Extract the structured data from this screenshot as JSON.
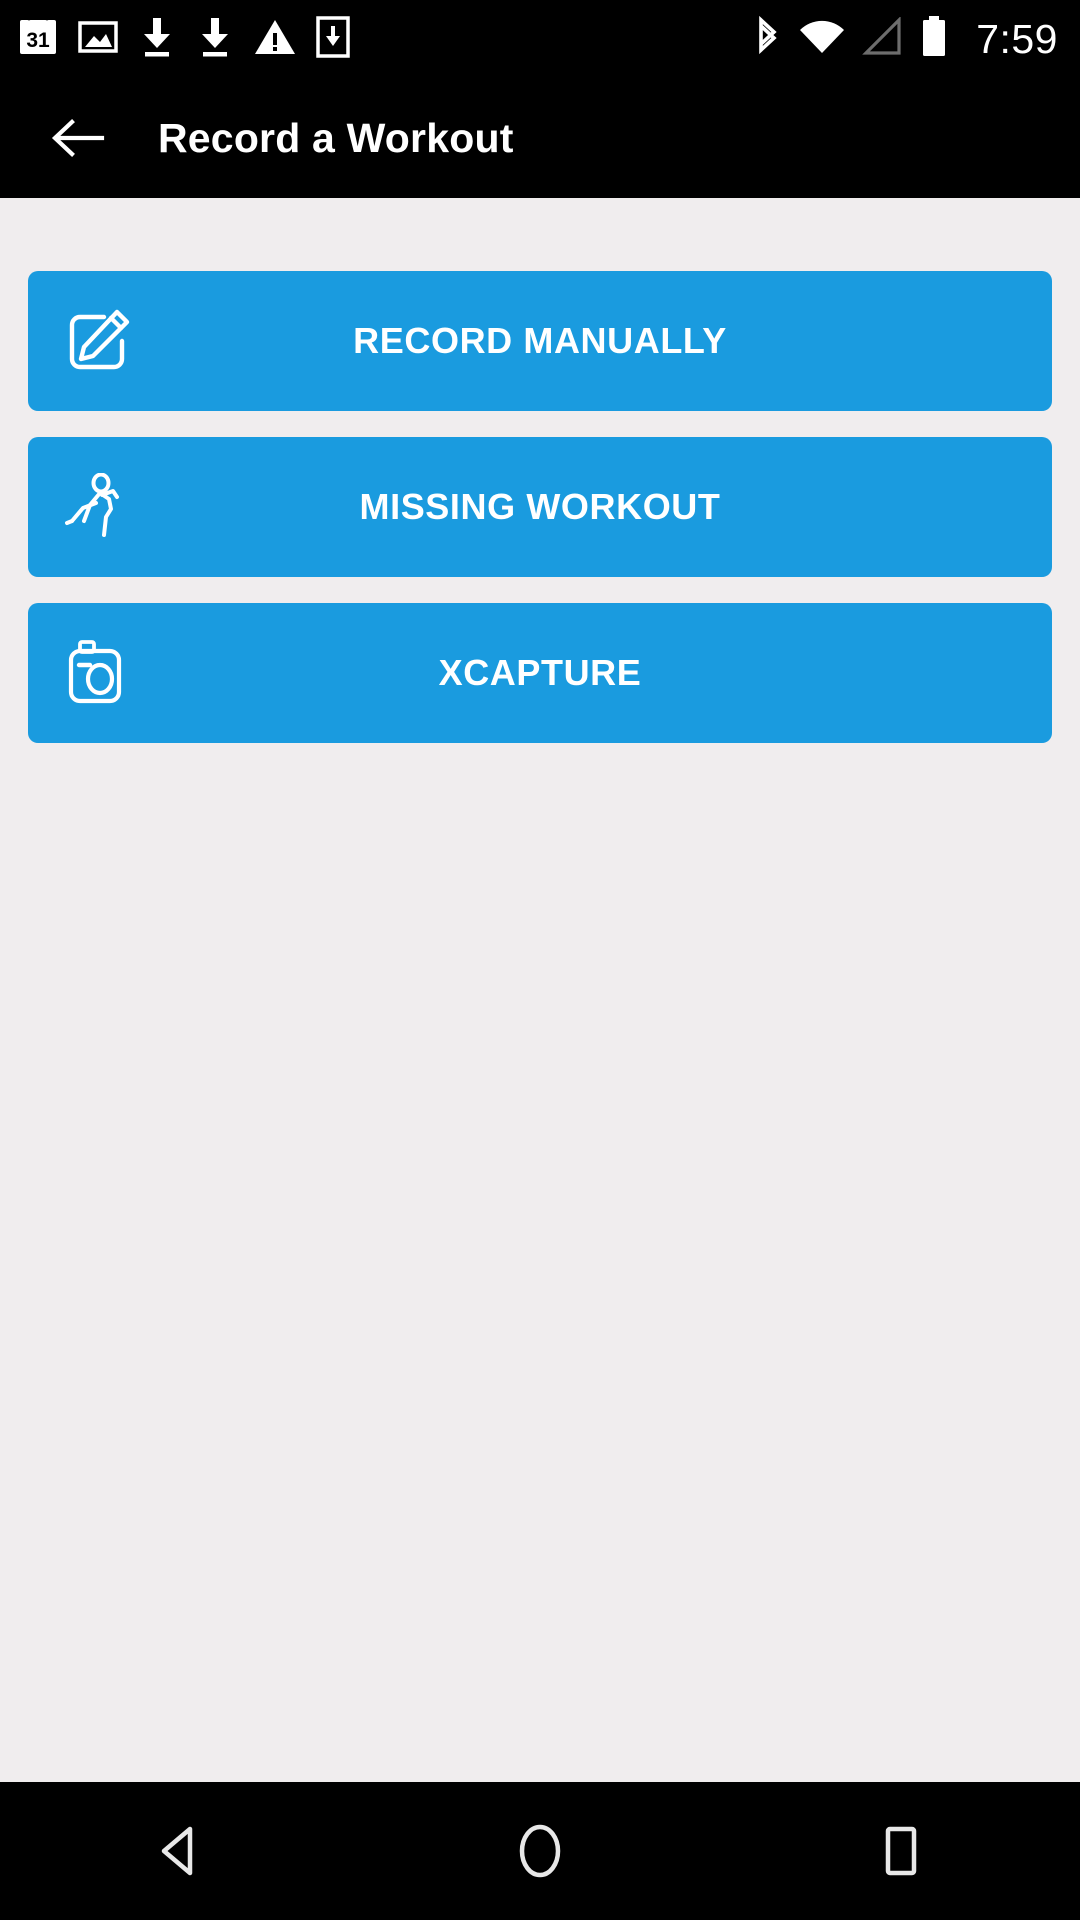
{
  "status_bar": {
    "time": "7:59",
    "left_icons": [
      {
        "name": "calendar-icon",
        "label": "31"
      },
      {
        "name": "image-icon",
        "label": ""
      },
      {
        "name": "download-icon",
        "label": ""
      },
      {
        "name": "download-icon-2",
        "label": ""
      },
      {
        "name": "warning-icon",
        "label": ""
      },
      {
        "name": "save-to-device-icon",
        "label": ""
      }
    ],
    "right_icons": [
      {
        "name": "bluetooth-icon"
      },
      {
        "name": "wifi-icon"
      },
      {
        "name": "cellular-signal-icon"
      },
      {
        "name": "battery-icon"
      }
    ]
  },
  "app_bar": {
    "title": "Record a Workout",
    "back_icon": "arrow-left-icon"
  },
  "main": {
    "buttons": [
      {
        "label": "RECORD MANUALLY",
        "icon": "edit-pencil-square-icon"
      },
      {
        "label": "MISSING WORKOUT",
        "icon": "running-person-icon"
      },
      {
        "label": "XCAPTURE",
        "icon": "camera-icon"
      }
    ]
  },
  "nav_bar": {
    "buttons": [
      {
        "name": "nav-back-button",
        "icon": "triangle-back-icon"
      },
      {
        "name": "nav-home-button",
        "icon": "circle-home-icon"
      },
      {
        "name": "nav-recents-button",
        "icon": "square-recents-icon"
      }
    ]
  },
  "colors": {
    "accent": "#1A9BDF",
    "background": "#F0EDEE",
    "bar": "#000000",
    "on_accent": "#FFFFFF"
  }
}
